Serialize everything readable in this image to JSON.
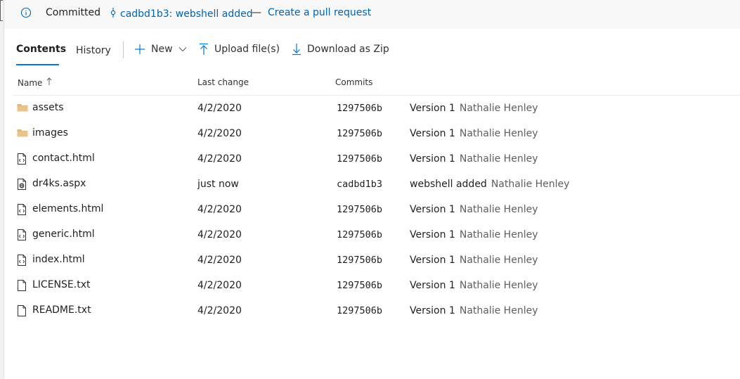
{
  "banner": {
    "status": "Committed",
    "commit_text": "cadbd1b3: webshell added",
    "separator": "—",
    "pr_link": "Create a pull request"
  },
  "tabs": [
    {
      "label": "Contents",
      "selected": true
    },
    {
      "label": "History",
      "selected": false
    }
  ],
  "toolbar": {
    "new_label": "New",
    "upload_label": "Upload file(s)",
    "download_label": "Download as Zip"
  },
  "columns": {
    "name": "Name",
    "last_change": "Last change",
    "commits": "Commits"
  },
  "files": [
    {
      "name": "assets",
      "type": "folder",
      "last_change": "4/2/2020",
      "commit_id": "1297506b",
      "commit_msg": "Version 1",
      "author": "Nathalie Henley"
    },
    {
      "name": "images",
      "type": "folder",
      "last_change": "4/2/2020",
      "commit_id": "1297506b",
      "commit_msg": "Version 1",
      "author": "Nathalie Henley"
    },
    {
      "name": "contact.html",
      "type": "code-file",
      "last_change": "4/2/2020",
      "commit_id": "1297506b",
      "commit_msg": "Version 1",
      "author": "Nathalie Henley"
    },
    {
      "name": "dr4ks.aspx",
      "type": "web-file",
      "last_change": "just now",
      "commit_id": "cadbd1b3",
      "commit_msg": "webshell added",
      "author": "Nathalie Henley"
    },
    {
      "name": "elements.html",
      "type": "code-file",
      "last_change": "4/2/2020",
      "commit_id": "1297506b",
      "commit_msg": "Version 1",
      "author": "Nathalie Henley"
    },
    {
      "name": "generic.html",
      "type": "code-file",
      "last_change": "4/2/2020",
      "commit_id": "1297506b",
      "commit_msg": "Version 1",
      "author": "Nathalie Henley"
    },
    {
      "name": "index.html",
      "type": "code-file",
      "last_change": "4/2/2020",
      "commit_id": "1297506b",
      "commit_msg": "Version 1",
      "author": "Nathalie Henley"
    },
    {
      "name": "LICENSE.txt",
      "type": "text-file",
      "last_change": "4/2/2020",
      "commit_id": "1297506b",
      "commit_msg": "Version 1",
      "author": "Nathalie Henley"
    },
    {
      "name": "README.txt",
      "type": "text-file",
      "last_change": "4/2/2020",
      "commit_id": "1297506b",
      "commit_msg": "Version 1",
      "author": "Nathalie Henley"
    }
  ],
  "icons": {
    "banner": "info-icon",
    "commit": "git-commit-icon",
    "new": "plus-icon",
    "new_menu": "chevron-down-icon",
    "upload": "upload-icon",
    "download": "download-icon",
    "sort": "sort-ascending-arrow-icon"
  },
  "colors": {
    "accent": "#0078d4",
    "link": "#0063b1",
    "folder": "#dcb67a",
    "banner_bg": "#f8f8f8"
  }
}
